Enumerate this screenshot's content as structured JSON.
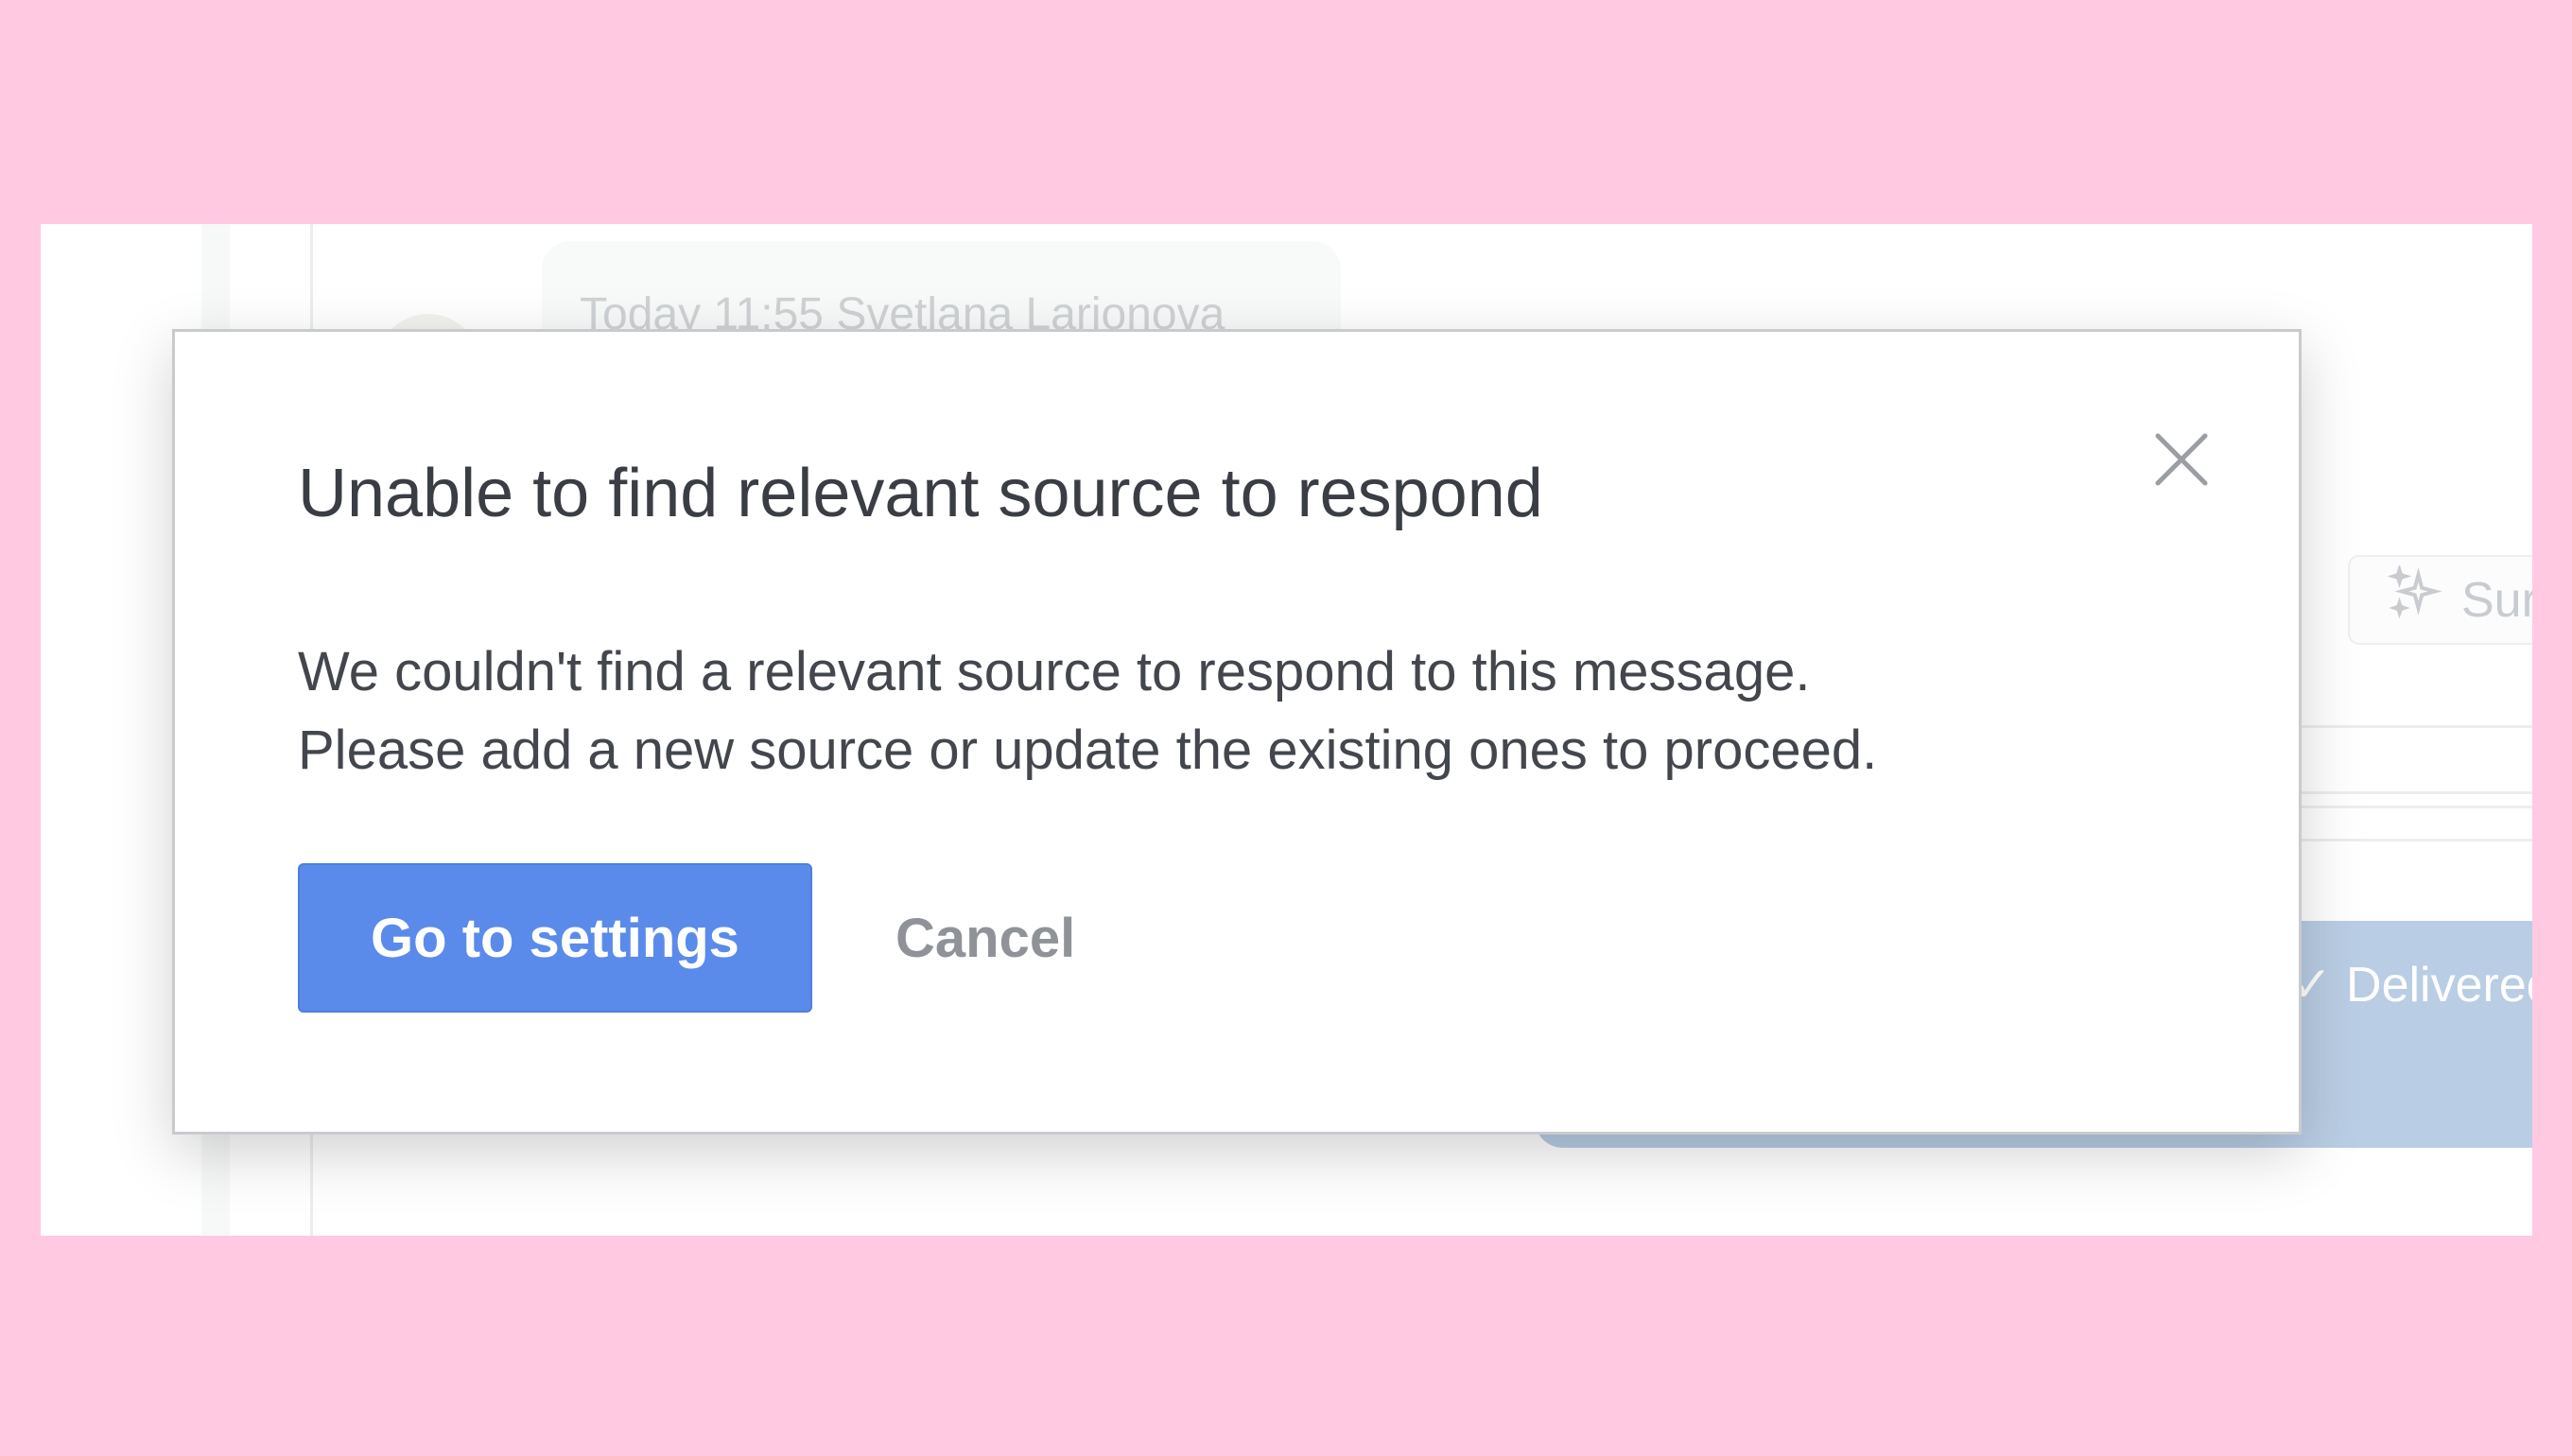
{
  "background": {
    "message_meta": "Today 11:55 Svetlana Larionova",
    "summary_button_label": "Sur",
    "summary_icon": "sparkles-icon",
    "delivered_status": "✓ Delivered"
  },
  "dialog": {
    "title": "Unable to find relevant source to respond",
    "body_line_1": "We couldn't find a relevant source to respond to this message.",
    "body_line_2": "Please add a new source or update the existing ones to proceed.",
    "primary_label": "Go to settings",
    "cancel_label": "Cancel",
    "close_icon": "close-icon"
  },
  "colors": {
    "page_background": "#ffc9e2",
    "primary_button": "#5b8bea",
    "title_text": "#3a3e44",
    "cancel_text": "#8f9398"
  }
}
